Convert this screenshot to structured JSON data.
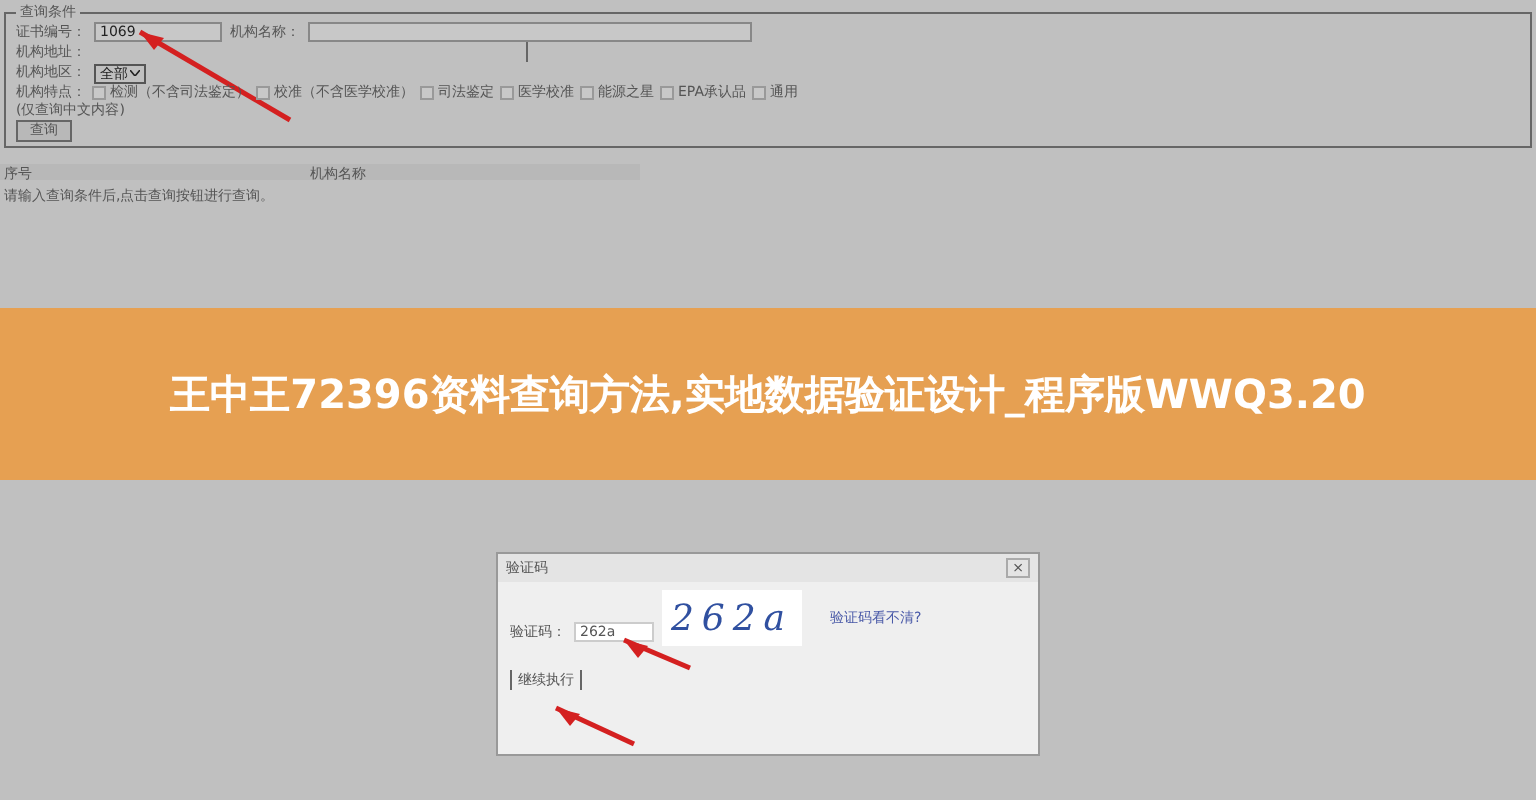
{
  "search_form": {
    "legend": "查询条件",
    "fields": [
      {
        "label": "证书编号：",
        "value": "1069"
      },
      {
        "label": "机构名称："
      }
    ],
    "address_label": "机构地址：",
    "region": {
      "label": "机构地区：",
      "value": "全部"
    },
    "features": {
      "label": "机构特点：",
      "options": [
        {
          "label": "检测（不含司法鉴定）",
          "checked": false
        },
        {
          "label": "校准（不含医学校准）",
          "checked": false
        },
        {
          "label": "司法鉴定",
          "checked": false
        },
        {
          "label": "医学校准",
          "checked": false
        },
        {
          "label": "能源之星",
          "checked": false
        },
        {
          "label": "EPA承认品",
          "checked": false
        },
        {
          "label": "通用",
          "checked": false
        }
      ]
    },
    "note": "(仅查询中文内容)",
    "button": "查询"
  },
  "table": {
    "columns": [
      "序号",
      "机构名称"
    ],
    "message": "请输入查询条件后,点击查询按钮进行查询。"
  },
  "banner": {
    "title": "王中王72396资料查询方法,实地数据验证设计_程序版WWQ3.20"
  },
  "dialog": {
    "title": "验证码",
    "close": "×",
    "label": "验证码：",
    "value": "262a",
    "captcha": "262a",
    "refresh_link": "验证码看不清?",
    "button": "继续执行"
  }
}
